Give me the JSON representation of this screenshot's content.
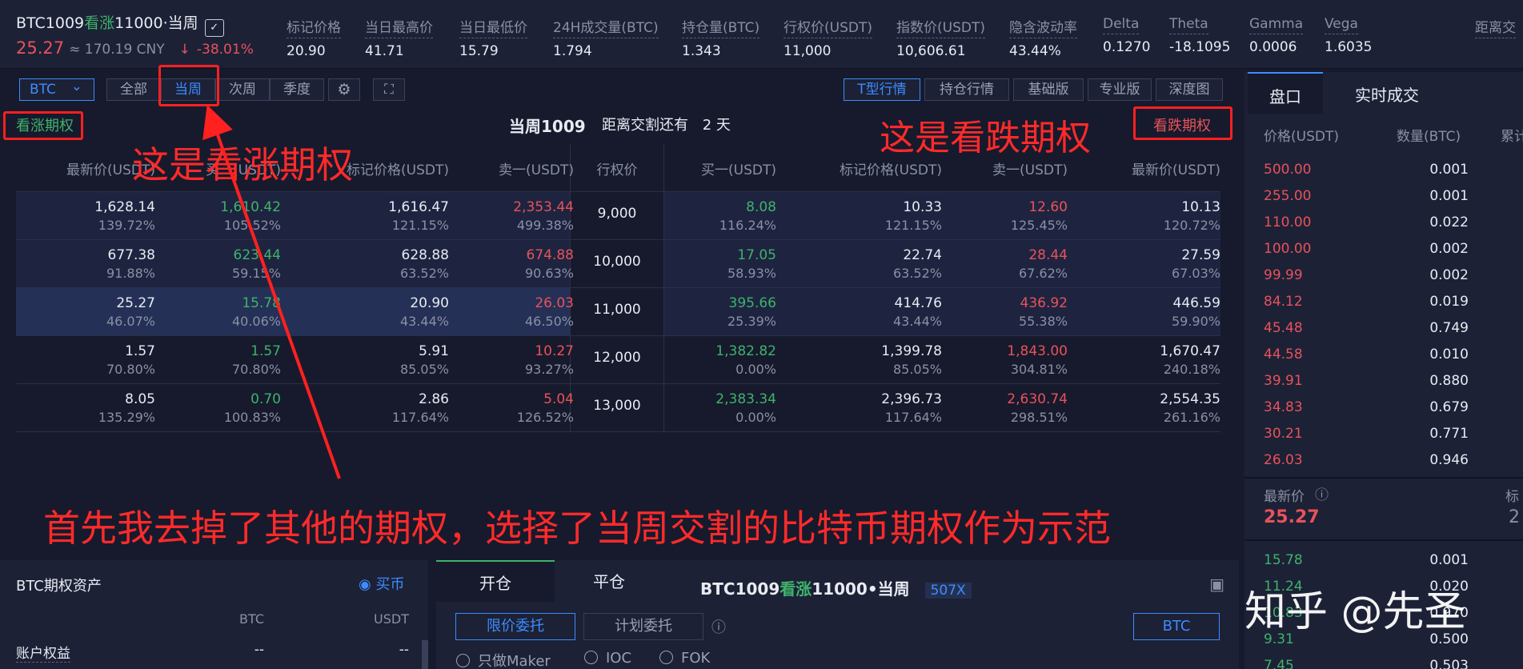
{
  "header": {
    "symbol_prefix": "BTC1009",
    "symbol_type": "看涨",
    "symbol_suffix": "11000·当周",
    "dropdown_glyph": "✓",
    "last_price": "25.27",
    "cny": "≈ 170.19 CNY",
    "arrow": "↓",
    "change": "-38.01%",
    "metrics": [
      {
        "label": "标记价格",
        "value": "20.90"
      },
      {
        "label": "当日最高价",
        "value": "41.71"
      },
      {
        "label": "当日最低价",
        "value": "15.79"
      },
      {
        "label": "24H成交量(BTC)",
        "value": "1.794"
      },
      {
        "label": "持仓量(BTC)",
        "value": "1.343"
      },
      {
        "label": "行权价(USDT)",
        "value": "11,000"
      },
      {
        "label": "指数价(USDT)",
        "value": "10,606.61"
      },
      {
        "label": "隐含波动率",
        "value": "43.44%"
      },
      {
        "label": "Delta",
        "value": "0.1270"
      },
      {
        "label": "Theta",
        "value": "-18.1095"
      },
      {
        "label": "Gamma",
        "value": "0.0006"
      },
      {
        "label": "Vega",
        "value": "1.6035"
      },
      {
        "label": "距离交",
        "value": ""
      }
    ]
  },
  "toolbar": {
    "coin": "BTC",
    "coin_caret": "⌄",
    "periods": [
      "全部",
      "当周",
      "次周",
      "季度"
    ],
    "settings_glyph": "⚙",
    "expand_glyph": "⛶",
    "views": [
      "T型行情",
      "持仓行情",
      "基础版",
      "专业版",
      "深度图"
    ]
  },
  "board": {
    "call_label": "看涨期权",
    "put_label": "看跌期权",
    "period": "当周1009",
    "expire_label": "距离交割还有",
    "expire_value": "2 天",
    "call_headers": [
      "最新价(USDT)",
      "买一(USDT)",
      "标记价格(USDT)",
      "卖一(USDT)"
    ],
    "strike_header": "行权价",
    "put_headers": [
      "买一(USDT)",
      "标记价格(USDT)",
      "卖一(USDT)",
      "最新价(USDT)"
    ],
    "rows": [
      {
        "strike": "9,000",
        "call": [
          [
            "1,628.14",
            "139.72%"
          ],
          [
            "1,610.42",
            "105.52%"
          ],
          [
            "1,616.47",
            "121.15%"
          ],
          [
            "2,353.44",
            "499.38%"
          ]
        ],
        "put": [
          [
            "8.08",
            "116.24%"
          ],
          [
            "10.33",
            "121.15%"
          ],
          [
            "12.60",
            "125.45%"
          ],
          [
            "10.13",
            "120.72%"
          ]
        ]
      },
      {
        "strike": "10,000",
        "call": [
          [
            "677.38",
            "91.88%"
          ],
          [
            "623.44",
            "59.15%"
          ],
          [
            "628.88",
            "63.52%"
          ],
          [
            "674.88",
            "90.63%"
          ]
        ],
        "put": [
          [
            "17.05",
            "58.93%"
          ],
          [
            "22.74",
            "63.52%"
          ],
          [
            "28.44",
            "67.62%"
          ],
          [
            "27.59",
            "67.03%"
          ]
        ]
      },
      {
        "strike": "11,000",
        "call": [
          [
            "25.27",
            "46.07%"
          ],
          [
            "15.78",
            "40.06%"
          ],
          [
            "20.90",
            "43.44%"
          ],
          [
            "26.03",
            "46.50%"
          ]
        ],
        "put": [
          [
            "395.66",
            "25.39%"
          ],
          [
            "414.76",
            "43.44%"
          ],
          [
            "436.92",
            "55.38%"
          ],
          [
            "446.59",
            "59.90%"
          ]
        ]
      },
      {
        "strike": "12,000",
        "call": [
          [
            "1.57",
            "70.80%"
          ],
          [
            "1.57",
            "70.80%"
          ],
          [
            "5.91",
            "85.05%"
          ],
          [
            "10.27",
            "93.27%"
          ]
        ],
        "put": [
          [
            "1,382.82",
            "0.00%"
          ],
          [
            "1,399.78",
            "85.05%"
          ],
          [
            "1,843.00",
            "304.81%"
          ],
          [
            "1,670.47",
            "240.18%"
          ]
        ]
      },
      {
        "strike": "13,000",
        "call": [
          [
            "8.05",
            "135.29%"
          ],
          [
            "0.70",
            "100.83%"
          ],
          [
            "2.86",
            "117.64%"
          ],
          [
            "5.04",
            "126.52%"
          ]
        ],
        "put": [
          [
            "2,383.34",
            "0.00%"
          ],
          [
            "2,396.73",
            "117.64%"
          ],
          [
            "2,630.74",
            "298.51%"
          ],
          [
            "2,554.35",
            "261.16%"
          ]
        ]
      }
    ]
  },
  "orderbook": {
    "tabs": [
      "盘口",
      "实时成交"
    ],
    "headers": [
      "价格(USDT)",
      "数量(BTC)",
      "累计"
    ],
    "asks": [
      [
        "500.00",
        "0.001"
      ],
      [
        "255.00",
        "0.001"
      ],
      [
        "110.00",
        "0.022"
      ],
      [
        "100.00",
        "0.002"
      ],
      [
        "99.99",
        "0.002"
      ],
      [
        "84.12",
        "0.019"
      ],
      [
        "45.48",
        "0.749"
      ],
      [
        "44.58",
        "0.010"
      ],
      [
        "39.91",
        "0.880"
      ],
      [
        "34.83",
        "0.679"
      ],
      [
        "30.21",
        "0.771"
      ],
      [
        "26.03",
        "0.946"
      ]
    ],
    "last_label": "最新价",
    "info_glyph": "ⓘ",
    "mark_label": "标",
    "last_value": "25.27",
    "mark_value": "2",
    "bids": [
      [
        "15.78",
        "0.001"
      ],
      [
        "11.24",
        "0.020"
      ],
      [
        "10.83",
        "0.970"
      ],
      [
        "9.31",
        "0.500"
      ],
      [
        "7.45",
        "0.503"
      ]
    ]
  },
  "assets": {
    "title": "BTC期权资产",
    "buy_coin": "买币",
    "coin_glyph": "◉",
    "col_btc": "BTC",
    "col_usdt": "USDT",
    "equity_label": "账户权益",
    "equity_btc": "--",
    "equity_usdt": "--"
  },
  "order": {
    "tab_open": "开仓",
    "tab_close": "平仓",
    "symbol_prefix": "BTC1009",
    "symbol_type": "看涨",
    "symbol_suffix": "11000•当周",
    "leverage": "507X",
    "calc_glyph": "▣",
    "limit": "限价委托",
    "plan": "计划委托",
    "info_glyph": "ⓘ",
    "unit": "BTC",
    "options": [
      "只做Maker",
      "IOC",
      "FOK"
    ]
  },
  "annotations": {
    "call_note": "这是看涨期权",
    "put_note": "这是看跌期权",
    "main_note": "首先我去掉了其他的期权，选择了当周交割的比特币期权作为示范",
    "watermark": "知乎 @先圣"
  },
  "colors": {
    "up": "#3fb26b",
    "down": "#e8525a",
    "accent": "#3d8cff",
    "annotation": "#ff2020",
    "background": "#161a2c"
  }
}
